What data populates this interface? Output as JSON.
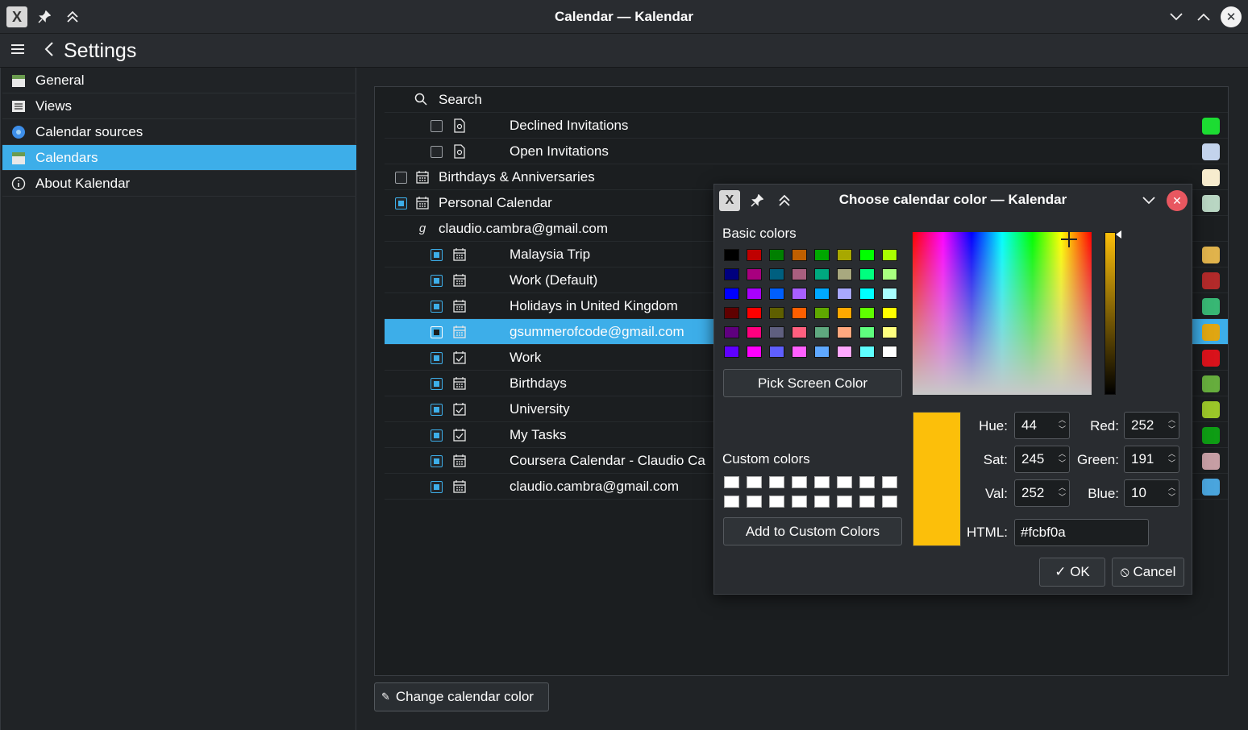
{
  "window": {
    "title": "Calendar — Kalendar"
  },
  "toolbar": {
    "heading": "Settings"
  },
  "sidebar": {
    "items": [
      {
        "label": "General",
        "active": false
      },
      {
        "label": "Views",
        "active": false
      },
      {
        "label": "Calendar sources",
        "active": false
      },
      {
        "label": "Calendars",
        "active": true
      },
      {
        "label": "About Kalendar",
        "active": false
      }
    ]
  },
  "calendars": {
    "search_label": "Search",
    "rows": [
      {
        "label": "Declined Invitations",
        "checked": false,
        "color": "#1cdc32"
      },
      {
        "label": "Open Invitations",
        "checked": false,
        "color": "#c3d3ec"
      },
      {
        "label": "Birthdays & Anniversaries",
        "checked": false,
        "color": "#f7ecce"
      },
      {
        "label": "Personal Calendar",
        "checked": true,
        "color": "#b9d6c3"
      },
      {
        "label": "claudio.cambra@gmail.com",
        "checked": null,
        "color": ""
      },
      {
        "label": "Malaysia Trip",
        "checked": true,
        "color": "#e0b34c"
      },
      {
        "label": "Work (Default)",
        "checked": true,
        "color": "#b22a2a"
      },
      {
        "label": "Holidays in United Kingdom",
        "checked": true,
        "color": "#38b774"
      },
      {
        "label": "gsummerofcode@gmail.com",
        "checked": true,
        "color": "#e0a612",
        "selected": true
      },
      {
        "label": "Work",
        "checked": true,
        "color": "#d9121b"
      },
      {
        "label": "Birthdays",
        "checked": true,
        "color": "#66ad3d"
      },
      {
        "label": "University",
        "checked": true,
        "color": "#9bc629"
      },
      {
        "label": "My Tasks",
        "checked": true,
        "color": "#0e9d14"
      },
      {
        "label": "Coursera Calendar - Claudio Ca",
        "checked": true,
        "color": "#c69ea4"
      },
      {
        "label": "claudio.cambra@gmail.com",
        "checked": true,
        "color": "#4aa5dd"
      }
    ],
    "change_button": "Change calendar color"
  },
  "dialog": {
    "title": "Choose calendar color — Kalendar",
    "basic_colors_label": "Basic colors",
    "basic_colors": [
      "#000000",
      "#bf0000",
      "#007f00",
      "#bf5f00",
      "#00a800",
      "#a8a800",
      "#00ff00",
      "#a8ff00",
      "#00007f",
      "#a8007f",
      "#005f7f",
      "#a85f7f",
      "#00a87f",
      "#a8a87f",
      "#00ff7f",
      "#a8ff7f",
      "#0000ff",
      "#a800ff",
      "#005fff",
      "#a85fff",
      "#00a8ff",
      "#a8a8ff",
      "#00ffff",
      "#a8ffff",
      "#5f0000",
      "#ff0000",
      "#5f5f00",
      "#ff5f00",
      "#5fa800",
      "#ffa800",
      "#5fff00",
      "#ffff00",
      "#5f007f",
      "#ff007f",
      "#5f5f7f",
      "#ff5f7f",
      "#5fa87f",
      "#ffa87f",
      "#5fff7f",
      "#ffff7f",
      "#5f00ff",
      "#ff00ff",
      "#5f5fff",
      "#ff5fff",
      "#5fa8ff",
      "#ffa8ff",
      "#5fffff",
      "#ffffff"
    ],
    "pick_screen_color": "Pick Screen Color",
    "custom_colors_label": "Custom colors",
    "add_custom": "Add to Custom Colors",
    "hue_label": "Hue:",
    "hue": "44",
    "sat_label": "Sat:",
    "sat": "245",
    "val_label": "Val:",
    "val": "252",
    "red_label": "Red:",
    "red": "252",
    "green_label": "Green:",
    "green": "191",
    "blue_label": "Blue:",
    "blue": "10",
    "html_label": "HTML:",
    "html": "#fcbf0a",
    "ok": "OK",
    "cancel": "Cancel",
    "current_color": "#fcbf0a"
  }
}
